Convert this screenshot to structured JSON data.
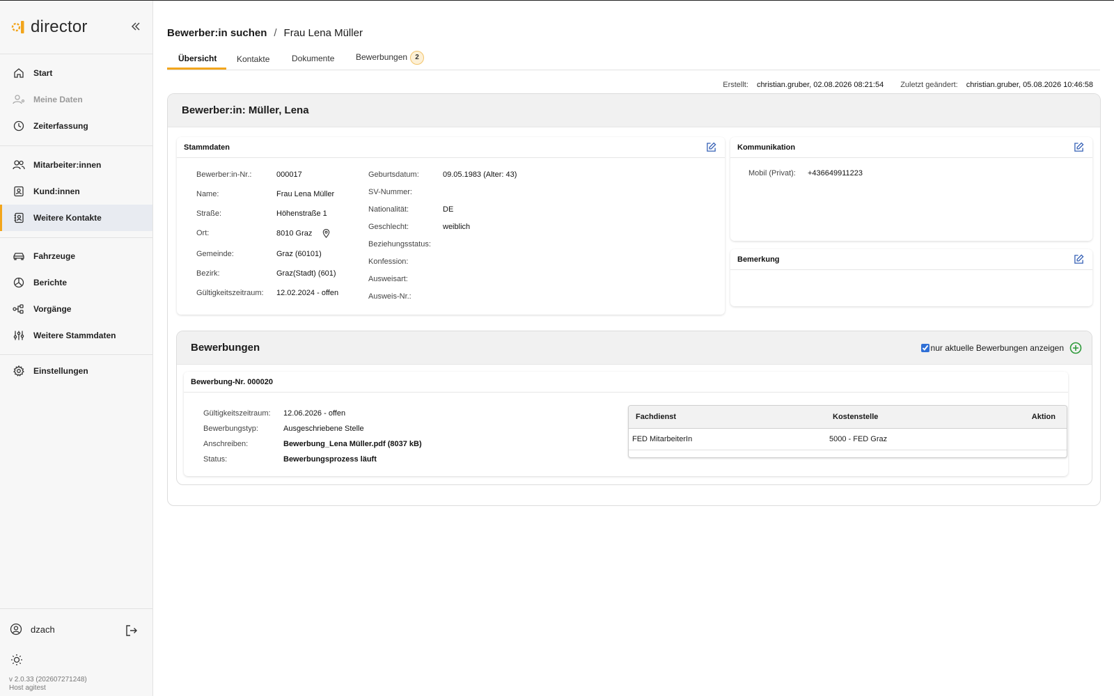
{
  "app": {
    "logo_text": "director",
    "version": "v 2.0.33 (202607271248)",
    "host": "Host agitest"
  },
  "sidebar": {
    "items": [
      {
        "label": "Start",
        "icon": "home-icon"
      },
      {
        "label": "Meine Daten",
        "icon": "user-icon",
        "disabled": true
      },
      {
        "label": "Zeiterfassung",
        "icon": "clock-icon"
      },
      {
        "label": "Mitarbeiter:innen",
        "icon": "users-icon"
      },
      {
        "label": "Kund:innen",
        "icon": "contact-card-icon"
      },
      {
        "label": "Weitere Kontakte",
        "icon": "contact-book-icon",
        "active": true
      },
      {
        "label": "Fahrzeuge",
        "icon": "car-icon"
      },
      {
        "label": "Berichte",
        "icon": "chart-icon"
      },
      {
        "label": "Vorgänge",
        "icon": "workflow-icon"
      },
      {
        "label": "Weitere Stammdaten",
        "icon": "sliders-icon"
      },
      {
        "label": "Einstellungen",
        "icon": "gear-icon"
      }
    ],
    "user": "dzach"
  },
  "breadcrumb": {
    "parent": "Bewerber:in suchen",
    "separator": "/",
    "current": "Frau Lena Müller"
  },
  "tabs": [
    {
      "label": "Übersicht",
      "active": true
    },
    {
      "label": "Kontakte"
    },
    {
      "label": "Dokumente"
    },
    {
      "label": "Bewerbungen",
      "badge": "2"
    }
  ],
  "meta": {
    "created_label": "Erstellt:",
    "created_value": "christian.gruber, 02.08.2026 08:21:54",
    "changed_label": "Zuletzt geändert:",
    "changed_value": "christian.gruber, 05.08.2026 10:46:58"
  },
  "panel": {
    "title": "Bewerber:in: Müller, Lena"
  },
  "stammdaten": {
    "title": "Stammdaten",
    "left": [
      {
        "k": "Bewerber:in-Nr.:",
        "v": "000017"
      },
      {
        "k": "Name:",
        "v": "Frau Lena Müller"
      },
      {
        "k": "Straße:",
        "v": "Höhenstraße 1"
      },
      {
        "k": "Ort:",
        "v": "8010 Graz"
      },
      {
        "k": "Gemeinde:",
        "v": "Graz (60101)"
      },
      {
        "k": "Bezirk:",
        "v": "Graz(Stadt) (601)"
      },
      {
        "k": "Gültigkeitszeitraum:",
        "v": "12.02.2024 - offen"
      }
    ],
    "right": [
      {
        "k": "Geburtsdatum:",
        "v": "09.05.1983 (Alter: 43)"
      },
      {
        "k": "SV-Nummer:",
        "v": ""
      },
      {
        "k": "Nationalität:",
        "v": "DE"
      },
      {
        "k": "Geschlecht:",
        "v": "weiblich"
      },
      {
        "k": "Beziehungsstatus:",
        "v": ""
      },
      {
        "k": "Konfession:",
        "v": ""
      },
      {
        "k": "Ausweisart:",
        "v": ""
      },
      {
        "k": "Ausweis-Nr.:",
        "v": ""
      }
    ]
  },
  "kommunikation": {
    "title": "Kommunikation",
    "k": "Mobil (Privat):",
    "v": "+436649911223"
  },
  "bemerkung": {
    "title": "Bemerkung"
  },
  "bewerbungen": {
    "title": "Bewerbungen",
    "filter_label": "nur aktuelle Bewerbungen anzeigen",
    "filter_checked": true,
    "item": {
      "title": "Bewerbung-Nr. 000020",
      "fields": [
        {
          "k": "Gültigkeitszeitraum:",
          "v": "12.06.2026 - offen"
        },
        {
          "k": "Bewerbungstyp:",
          "v": "Ausgeschriebene Stelle"
        },
        {
          "k": "Anschreiben:",
          "v": "Bewerbung_Lena Müller.pdf (8037 kB)"
        },
        {
          "k": "Status:",
          "v": "Bewerbungsprozess läuft"
        }
      ],
      "table": {
        "headers": [
          "Fachdienst",
          "Kostenstelle",
          "Aktion"
        ],
        "rows": [
          [
            "FED MitarbeiterIn",
            "5000 - FED Graz",
            ""
          ]
        ]
      }
    }
  },
  "colors": {
    "accent": "#f2a51c",
    "link": "#2a4fa8",
    "add": "#2e9a3a",
    "edit": "#3560b5"
  }
}
